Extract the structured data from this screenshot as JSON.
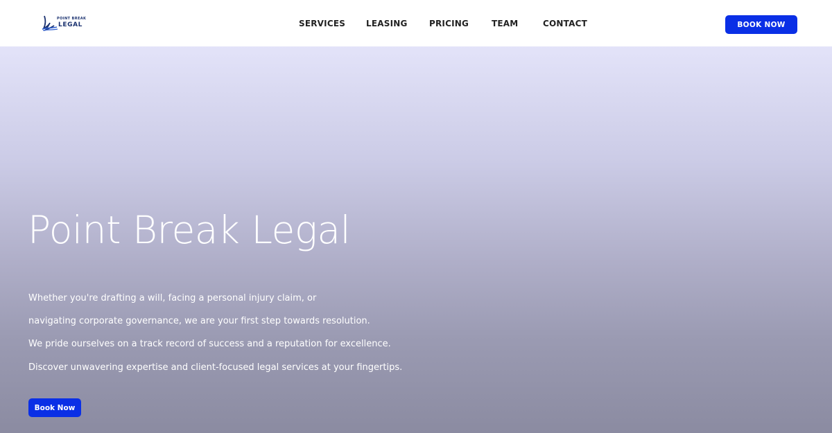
{
  "brand": {
    "logo_top": "POINT BREAK",
    "logo_bottom": "LEGAL",
    "logo_icon": "wave-sail-icon",
    "accent_color": "#0a2fe6",
    "text_color": "#1b3270"
  },
  "nav": {
    "items": [
      {
        "label": "SERVICES"
      },
      {
        "label": "LEASING"
      },
      {
        "label": "PRICING"
      },
      {
        "label": "TEAM"
      },
      {
        "label": "CONTACT"
      }
    ],
    "cta_label": "BOOK NOW"
  },
  "hero": {
    "title": "Point Break Legal",
    "lines": [
      "Whether you're drafting a will, facing a personal injury claim, or",
      "navigating corporate governance, we are your first step towards resolution.",
      "We pride ourselves on a track record of success and a reputation for excellence.",
      "Discover unwavering expertise and client-focused legal services at your fingertips."
    ],
    "cta_label": "Book Now"
  }
}
